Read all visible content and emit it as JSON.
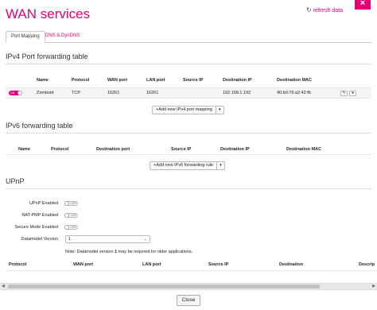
{
  "dialog": {
    "title": "WAN services",
    "refresh_label": "refresh data",
    "close_glyph": "×",
    "close_button": "Close"
  },
  "tabs": [
    {
      "label": "Port Mapping",
      "active": true
    },
    {
      "label": "DNS & DynDNS",
      "active": false
    }
  ],
  "ipv4": {
    "section_title": "IPv4 Port forwarding table",
    "headers": [
      "Name",
      "Protocol",
      "WAN port",
      "LAN port",
      "Source IP",
      "Destination IP",
      "Destination MAC"
    ],
    "rows": [
      {
        "enabled": "ON",
        "name": "Zomboid",
        "protocol": "TCP",
        "wan_port": "16261",
        "lan_port": "16261",
        "source_ip": "",
        "destination_ip": "192.168.1.192",
        "destination_mac": "40:b0:76:a2:42:fb"
      }
    ],
    "add_button": "Add new IPv4 port mapping"
  },
  "ipv6": {
    "section_title": "IPv6 forwarding table",
    "headers": [
      "Name",
      "Protocol",
      "Destination port",
      "Source IP",
      "Destination IP",
      "Destination MAC"
    ],
    "add_button": "Add new IPv6 forwarding rule"
  },
  "upnp": {
    "section_title": "UPnP",
    "fields": [
      {
        "label": "UPnP Enabled",
        "state": "OFF"
      },
      {
        "label": "NAT-PMP Enabled",
        "state": "OFF"
      },
      {
        "label": "Secure Mode Enabled",
        "state": "OFF"
      }
    ],
    "datamodel_label": "Datamodel Version",
    "datamodel_value": "1",
    "note_prefix": "Note: Datamodel version ",
    "note_bold": "1",
    "note_suffix": " may be required for older applications.",
    "headers": [
      "Protocol",
      "WAN port",
      "LAN port",
      "Source IP",
      "Destination",
      "Descrip"
    ]
  },
  "colors": {
    "accent": "#e20074"
  },
  "icons": [
    "refresh-icon",
    "plus-icon",
    "edit-icon",
    "delete-icon",
    "caret-down-icon",
    "close-icon"
  ]
}
